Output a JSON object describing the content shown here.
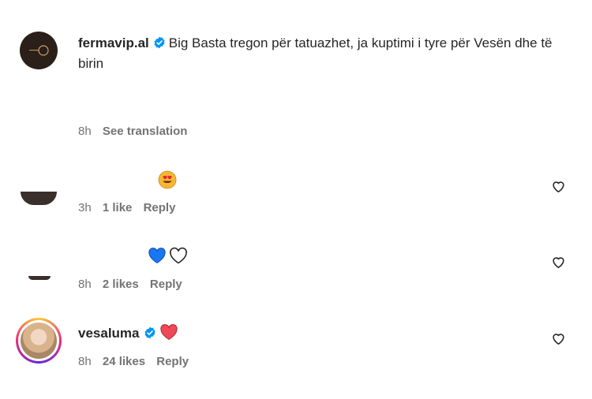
{
  "post": {
    "username": "fermavip.al",
    "caption": "Big Basta tregon për tatuazhet, ja kuptimi i tyre për Vesën dhe të birin",
    "time": "8h",
    "translation_link": "See translation"
  },
  "comments": [
    {
      "emoji": "heart-eyes-emoji",
      "time": "3h",
      "likes": "1 like",
      "reply": "Reply"
    },
    {
      "emoji": "blue-and-white-hearts",
      "time": "8h",
      "likes": "2 likes",
      "reply": "Reply"
    },
    {
      "username": "vesaluma",
      "emoji": "red-heart",
      "time": "8h",
      "likes": "24 likes",
      "reply": "Reply"
    }
  ],
  "colors": {
    "verified": "#0095f6",
    "meta_text": "#737373",
    "text": "#262626",
    "red_heart": "#ed4956",
    "blue_heart": "#1877f2"
  },
  "icons": [
    "verified-badge-icon",
    "like-heart-outline-icon"
  ]
}
